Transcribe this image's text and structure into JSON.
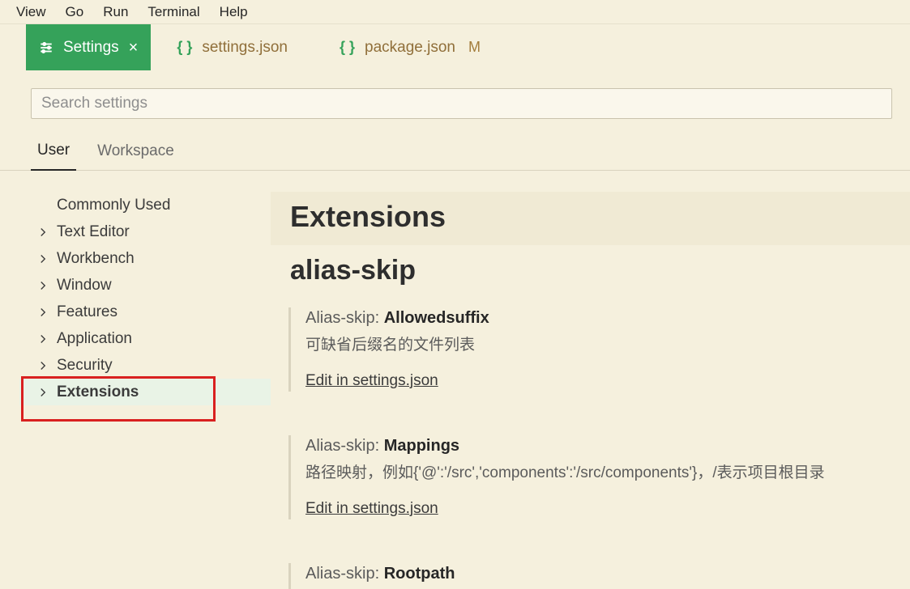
{
  "menubar": {
    "items": [
      "View",
      "Go",
      "Run",
      "Terminal",
      "Help"
    ]
  },
  "tabs": {
    "active": {
      "label": "Settings"
    },
    "json1": {
      "label": "settings.json"
    },
    "json2": {
      "label": "package.json",
      "modified": "M"
    }
  },
  "search": {
    "placeholder": "Search settings"
  },
  "scopes": {
    "user": "User",
    "workspace": "Workspace"
  },
  "sidebar": {
    "items": [
      "Commonly Used",
      "Text Editor",
      "Workbench",
      "Window",
      "Features",
      "Application",
      "Security",
      "Extensions"
    ]
  },
  "detail": {
    "heading": "Extensions",
    "subheading": "alias-skip",
    "blocks": [
      {
        "prefix": "Alias-skip: ",
        "name": "Allowedsuffix",
        "desc": "可缺省后缀名的文件列表",
        "edit": "Edit in settings.json"
      },
      {
        "prefix": "Alias-skip: ",
        "name": "Mappings",
        "desc": "路径映射，例如{'@':'/src','components':'/src/components'}，/表示项目根目录",
        "edit": "Edit in settings.json"
      },
      {
        "prefix": "Alias-skip: ",
        "name": "Rootpath",
        "desc": "",
        "edit": ""
      }
    ]
  }
}
